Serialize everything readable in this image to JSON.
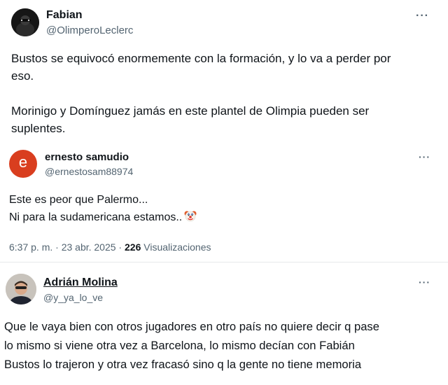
{
  "tweet1": {
    "name": "Fabian",
    "handle": "@OlimperoLeclerc",
    "text_lines": [
      "Bustos se equivocó enormemente con la formación, y lo va a perder por",
      "eso.",
      "",
      "Morinigo y Domínguez jamás en este plantel de Olimpia pueden ser",
      "suplentes."
    ],
    "more": "···"
  },
  "tweet2": {
    "avatar_letter": "e",
    "avatar_color": "#d93e1f",
    "name": "ernesto samudio",
    "handle": "@ernestosam88974",
    "line1": "Este es peor que Palermo...",
    "line2": "Ni para la sudamericana estamos..",
    "emoji_name": "clown-face-icon",
    "more": "···",
    "timestamp": "6:37 p. m. · 23 abr. 2025 · ",
    "views_count": "226",
    "views_label": " Visualizaciones"
  },
  "tweet3": {
    "name": "Adrián Molina",
    "handle": "@y_ya_lo_ve",
    "text_lines": [
      "Que le vaya bien con otros jugadores en otro país no quiere decir q pase",
      "lo mismo si viene otra vez a Barcelona, lo mismo decían con Fabián",
      "Bustos lo trajeron y otra vez fracasó sino q la gente no tiene memoria"
    ],
    "more": "···"
  }
}
